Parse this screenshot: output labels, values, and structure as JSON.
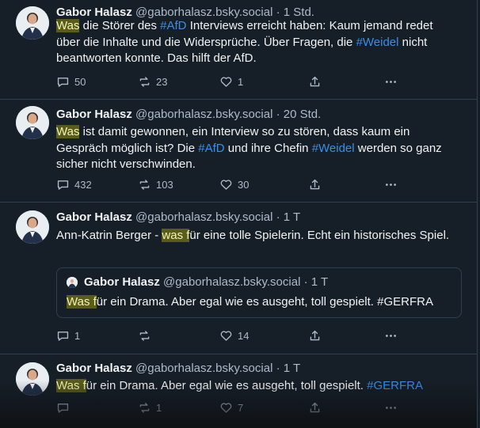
{
  "posts": [
    {
      "author": "Gabor Halasz",
      "handle": "@gaborhalasz.bsky.social",
      "time": "· 1 Std.",
      "text_parts": [
        {
          "t": "Was",
          "k": "hl"
        },
        {
          "t": " die Störer des ",
          "k": ""
        },
        {
          "t": "#AfD",
          "k": "tag"
        },
        {
          "t": " Interviews erreicht haben: Kaum jemand redet über die Inhalte und die Widersprüche. Über Fragen, die ",
          "k": ""
        },
        {
          "t": "#Weidel",
          "k": "tag"
        },
        {
          "t": " nicht beantworten konnte. Das hilft der AfD.",
          "k": ""
        }
      ],
      "replies": "50",
      "reposts": "23",
      "likes": "1"
    },
    {
      "author": "Gabor Halasz",
      "handle": "@gaborhalasz.bsky.social",
      "time": "· 20 Std.",
      "text_parts": [
        {
          "t": "Was",
          "k": "hl"
        },
        {
          "t": " ist damit gewonnen, ein Interview so zu stören, dass kaum ein Gespräch möglich ist? Die ",
          "k": ""
        },
        {
          "t": "#AfD",
          "k": "tag"
        },
        {
          "t": " und ihre Chefin ",
          "k": ""
        },
        {
          "t": "#Weidel",
          "k": "tag"
        },
        {
          "t": " werden so ganz sicher nicht verschwinden.",
          "k": ""
        }
      ],
      "replies": "432",
      "reposts": "103",
      "likes": "30"
    },
    {
      "author": "Gabor Halasz",
      "handle": "@gaborhalasz.bsky.social",
      "time": "· 1 T",
      "text_parts": [
        {
          "t": "Ann-Katrin Berger - ",
          "k": ""
        },
        {
          "t": "was f",
          "k": "hl"
        },
        {
          "t": "ür eine tolle Spielerin. Echt ein historisches Spiel.",
          "k": ""
        }
      ],
      "quote": {
        "author": "Gabor Halasz",
        "handle": "@gaborhalasz.bsky.social",
        "time": "· 1 T",
        "text_parts": [
          {
            "t": "Was f",
            "k": "hl"
          },
          {
            "t": "ür ein Drama. Aber egal wie es ausgeht, toll gespielt. #GERFRA",
            "k": ""
          }
        ]
      },
      "replies": "1",
      "reposts": "",
      "likes": "14"
    },
    {
      "author": "Gabor Halasz",
      "handle": "@gaborhalasz.bsky.social",
      "time": "· 1 T",
      "text_parts": [
        {
          "t": "Was f",
          "k": "hl"
        },
        {
          "t": "ür ein Drama. Aber egal wie es ausgeht, toll gespielt. ",
          "k": ""
        },
        {
          "t": "#GERFRA",
          "k": "tag"
        }
      ],
      "replies": "",
      "reposts": "1",
      "likes": "7"
    }
  ],
  "icons": {
    "reply": "reply-icon",
    "repost": "repost-icon",
    "like": "heart-icon",
    "share": "share-icon",
    "more": "more-icon"
  },
  "colors": {
    "background": "#161e27",
    "highlight": "#595c1b",
    "hashtag": "#3b8eea",
    "muted": "#aebbc9"
  }
}
